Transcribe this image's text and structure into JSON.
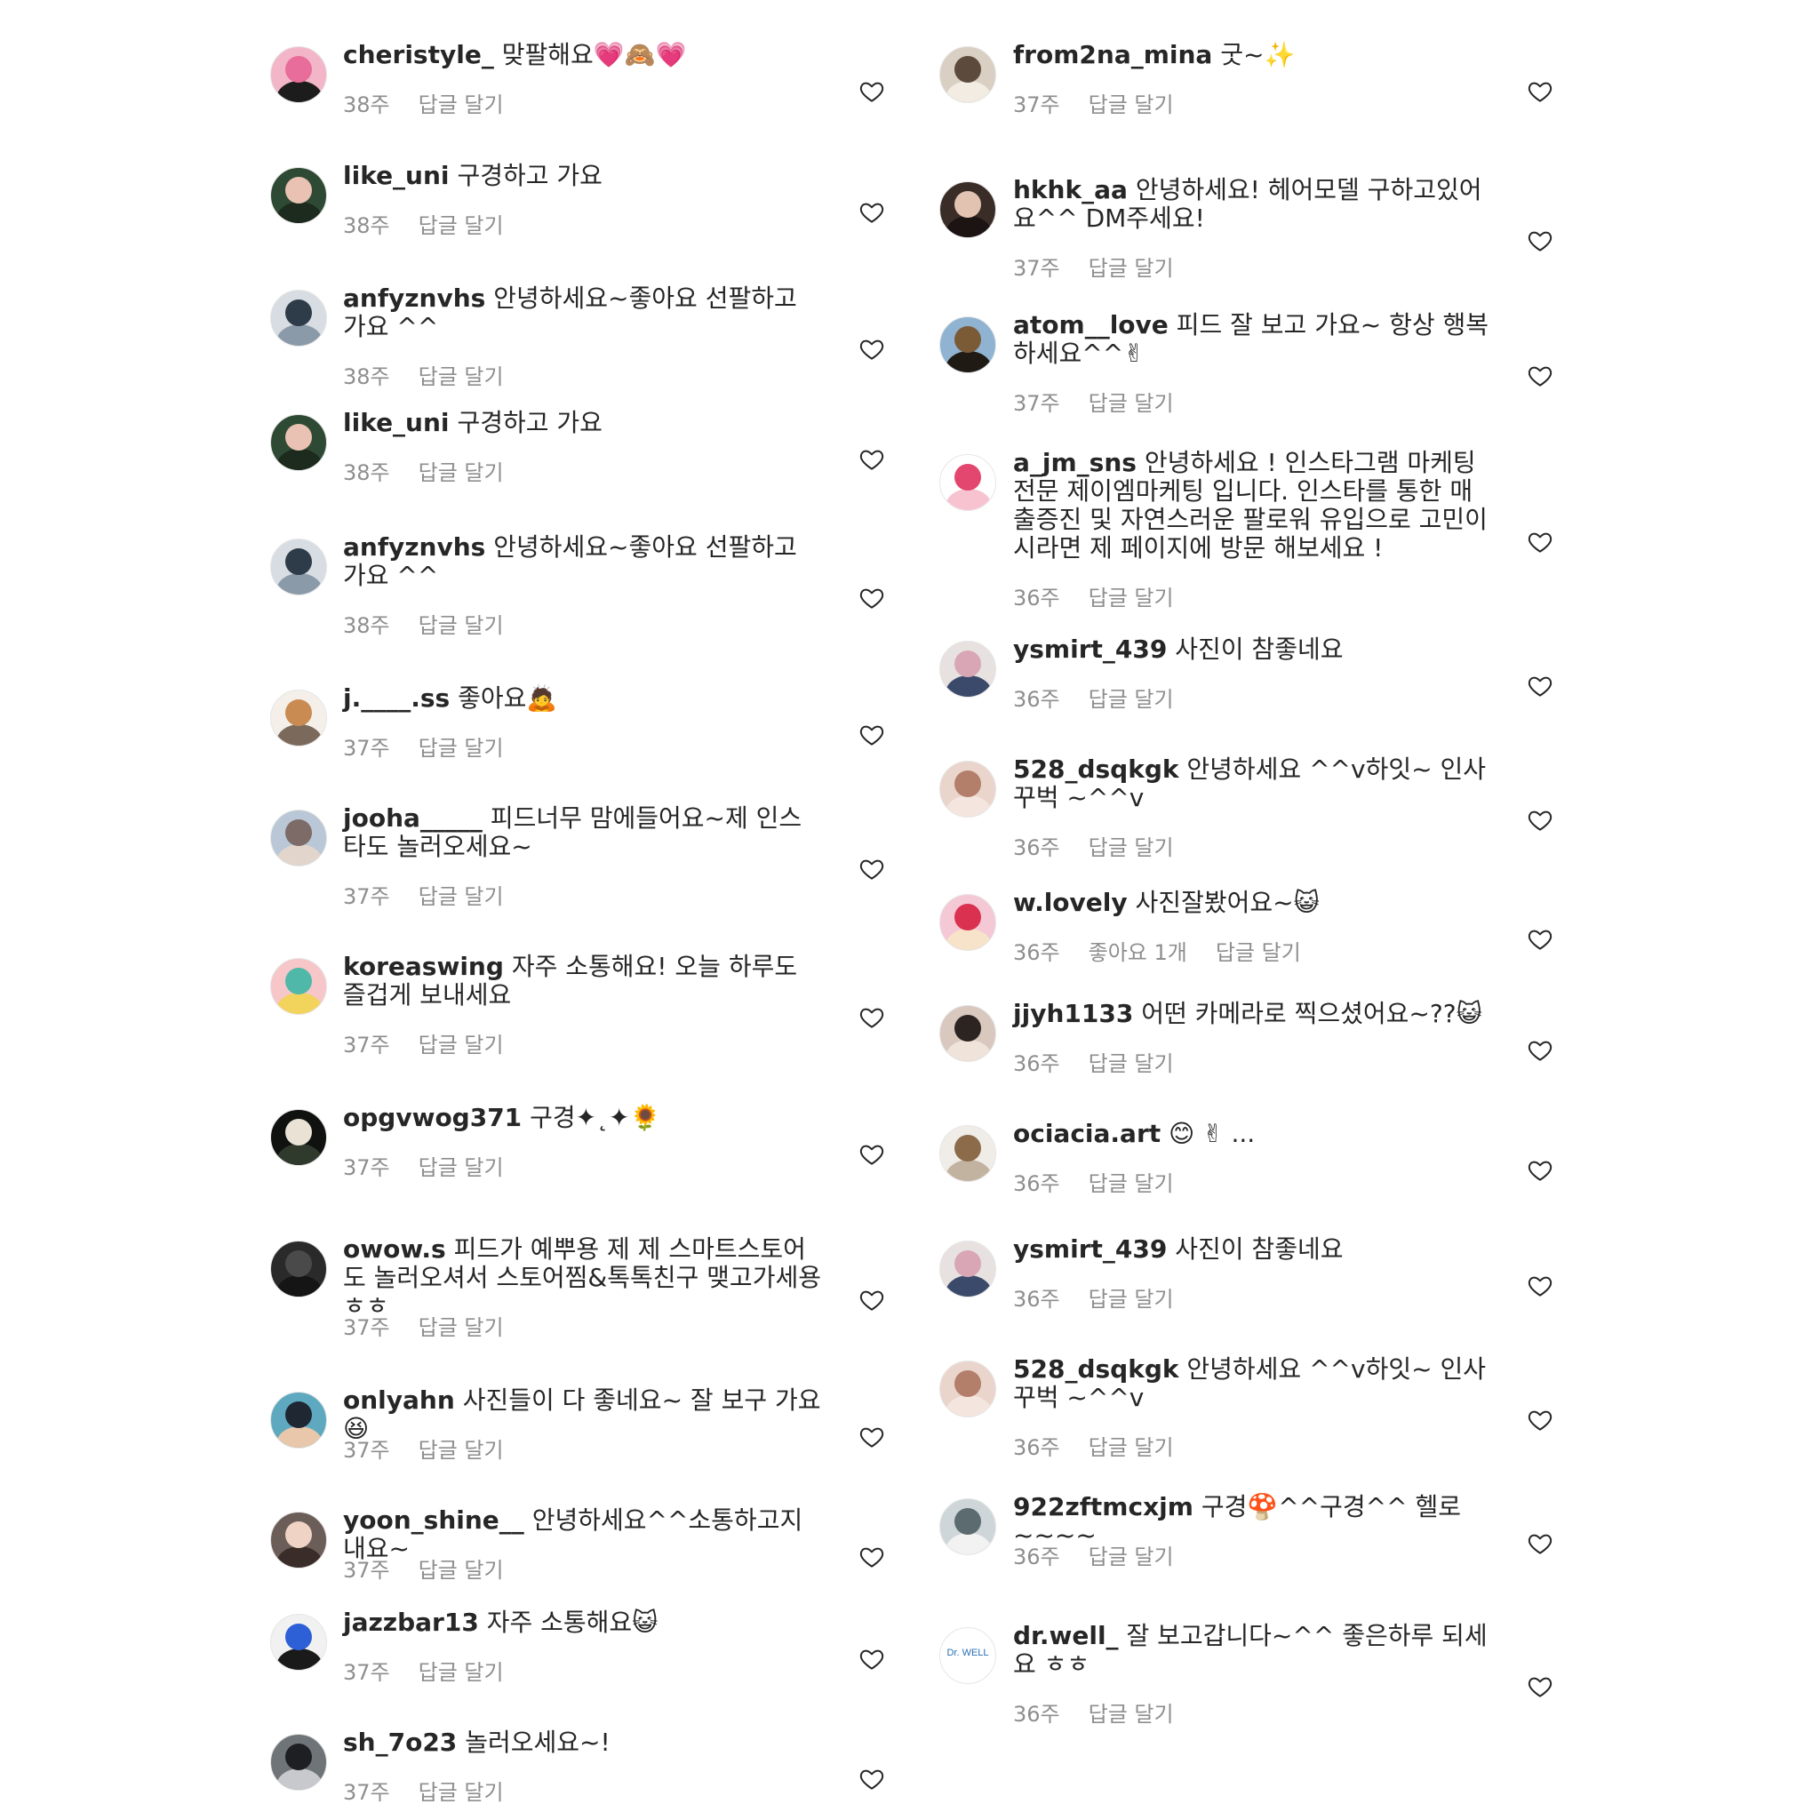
{
  "left": [
    {
      "username": "cheristyle_",
      "text": "맞팔해요💗🙈💗",
      "time": "38주",
      "reply": "답글 달기",
      "avatar": [
        "#f2b6c8",
        "#e86d9a",
        "#1c1c1c"
      ]
    },
    {
      "username": "like_uni",
      "text": "구경하고 가요",
      "time": "38주",
      "reply": "답글 달기",
      "avatar": [
        "#2f4a34",
        "#e9c2b3",
        "#1d2a1e"
      ]
    },
    {
      "username": "anfyznvhs",
      "text": "안녕하세요~좋아요 선팔하고 가요 ^^",
      "time": "38주",
      "reply": "답글 달기",
      "avatar": [
        "#d7dde2",
        "#2e3b49",
        "#8a9aa8"
      ]
    },
    {
      "username": "like_uni",
      "text": "구경하고 가요",
      "time": "38주",
      "reply": "답글 달기",
      "avatar": [
        "#2f4a34",
        "#e9c2b3",
        "#1d2a1e"
      ]
    },
    {
      "username": "anfyznvhs",
      "text": "안녕하세요~좋아요 선팔하고 가요 ^^",
      "time": "38주",
      "reply": "답글 달기",
      "avatar": [
        "#d7dde2",
        "#2e3b49",
        "#8a9aa8"
      ]
    },
    {
      "username": "j.____.ss",
      "text": "좋아요🙇",
      "time": "37주",
      "reply": "답글 달기",
      "avatar": [
        "#f4efe8",
        "#c98b52",
        "#7b6a5b"
      ]
    },
    {
      "username": "jooha_____",
      "text": "피드너무 맘에들어요~제 인스타도 놀러오세요~",
      "time": "37주",
      "reply": "답글 달기",
      "avatar": [
        "#b9c7d6",
        "#7c6b66",
        "#e2d6cc"
      ]
    },
    {
      "username": "koreaswing",
      "text": "자주 소통해요! 오늘 하루도 즐겁게 보내세요",
      "time": "37주",
      "reply": "답글 달기",
      "avatar": [
        "#f7c6c9",
        "#4fb8a9",
        "#f2d35b"
      ]
    },
    {
      "username": "opgvwog371",
      "text": "구경✦˛✦🌻",
      "time": "37주",
      "reply": "답글 달기",
      "avatar": [
        "#101210",
        "#e9e2d5",
        "#2f3a2c"
      ]
    },
    {
      "username": "owow.s",
      "text": "피드가 예뿌용 제 제 스마트스토어도 놀러오셔서 스토어찜&톡톡친구 맺고가세용ㅎㅎ",
      "time": "37주",
      "reply": "답글 달기",
      "avatar": [
        "#2a2a2a",
        "#4a4a4a",
        "#151515"
      ]
    },
    {
      "username": "onlyahn",
      "text": "사진들이 다 좋네요~ 잘 보구 가요😆",
      "time": "37주",
      "reply": "답글 달기",
      "avatar": [
        "#5ea9bf",
        "#1f2733",
        "#e8c7aa"
      ]
    },
    {
      "username": "yoon_shine__",
      "text": "안녕하세요^^소통하고지내요~",
      "time": "37주",
      "reply": "답글 달기",
      "avatar": [
        "#6b5d58",
        "#efd3c4",
        "#3a2d29"
      ]
    },
    {
      "username": "jazzbar13",
      "text": "자주 소통해요😺",
      "time": "37주",
      "reply": "답글 달기",
      "avatar": [
        "#f1f1f1",
        "#2d5fd6",
        "#1a1a1a"
      ]
    },
    {
      "username": "sh_7o23",
      "text": "놀러오세요~!",
      "time": "37주",
      "reply": "답글 달기",
      "avatar": [
        "#6f7478",
        "#1d1f22",
        "#c7c9cc"
      ]
    }
  ],
  "right": [
    {
      "username": "from2na_mina",
      "text": "굿~✨",
      "time": "37주",
      "reply": "답글 달기",
      "avatar": [
        "#d9cfc2",
        "#5c4a3c",
        "#f3ece3"
      ]
    },
    {
      "username": "hkhk_aa",
      "text": "안녕하세요! 헤어모델 구하고있어요^^ DM주세요!",
      "time": "37주",
      "reply": "답글 달기",
      "avatar": [
        "#3a2c27",
        "#e2c3b1",
        "#1b1412"
      ]
    },
    {
      "username": "atom__love",
      "text": "피드 잘 보고 가요~ 항상 행복하세요^^✌",
      "time": "37주",
      "reply": "답글 달기",
      "avatar": [
        "#8fb3d1",
        "#7b5a36",
        "#1f1a14"
      ]
    },
    {
      "username": "a_jm_sns",
      "text": "안녕하세요 ! 인스타그램 마케팅 전문 제이엠마케팅 입니다. 인스타를 통한 매출증진 및 자연스러운 팔로워 유입으로 고민이시라면 제 페이지에 방문 해보세요 !",
      "time": "36주",
      "reply": "답글 달기",
      "avatar": [
        "#ffffff",
        "#e3466f",
        "#f7c3d1"
      ]
    },
    {
      "username": "ysmirt_439",
      "text": "사진이 참좋네요",
      "time": "36주",
      "reply": "답글 달기",
      "avatar": [
        "#e7e2e0",
        "#d9a6b6",
        "#3b4a6a"
      ]
    },
    {
      "username": "528_dsqkgk",
      "text": "안녕하세요 ^^v하잇~ 인사 꾸벅 ~^^v",
      "time": "36주",
      "reply": "답글 달기",
      "avatar": [
        "#ead5cc",
        "#b37e6a",
        "#f4e6df"
      ]
    },
    {
      "username": "w.lovely",
      "text": "사진잘봤어요~😺",
      "time": "36주",
      "likes": "좋아요 1개",
      "reply": "답글 달기",
      "avatar": [
        "#f4c9d5",
        "#d9314f",
        "#f7e3c9"
      ]
    },
    {
      "username": "jjyh1133",
      "text": "어떤 카메라로 찍으셨어요~??😺",
      "time": "36주",
      "reply": "답글 달기",
      "avatar": [
        "#d8c8be",
        "#2c2420",
        "#efe3da"
      ]
    },
    {
      "username": "ociacia.art",
      "text": "😊 ✌ ...",
      "time": "36주",
      "reply": "답글 달기",
      "avatar": [
        "#f0ede8",
        "#8b6b4a",
        "#c2b3a1"
      ]
    },
    {
      "username": "ysmirt_439",
      "text": "사진이 참좋네요",
      "time": "36주",
      "reply": "답글 달기",
      "avatar": [
        "#e7e2e0",
        "#d9a6b6",
        "#3b4a6a"
      ]
    },
    {
      "username": "528_dsqkgk",
      "text": "안녕하세요 ^^v하잇~ 인사 꾸벅 ~^^v",
      "time": "36주",
      "reply": "답글 달기",
      "avatar": [
        "#ead5cc",
        "#b37e6a",
        "#f4e6df"
      ]
    },
    {
      "username": "922zftmcxjm",
      "text": "구경🍄^^구경^^ 헬로~~~~",
      "time": "36주",
      "reply": "답글 달기",
      "avatar": [
        "#cfd6d9",
        "#5b6b70",
        "#f2f2f2"
      ]
    },
    {
      "username": "dr.well_",
      "text": "잘 보고갑니다~^^ 좋은하루 되세요 ㅎㅎ",
      "time": "36주",
      "reply": "답글 달기",
      "avatar": [
        "#ffffff",
        "#2b6fb4",
        "#ffffff"
      ],
      "logo": "Dr. WELL"
    }
  ]
}
